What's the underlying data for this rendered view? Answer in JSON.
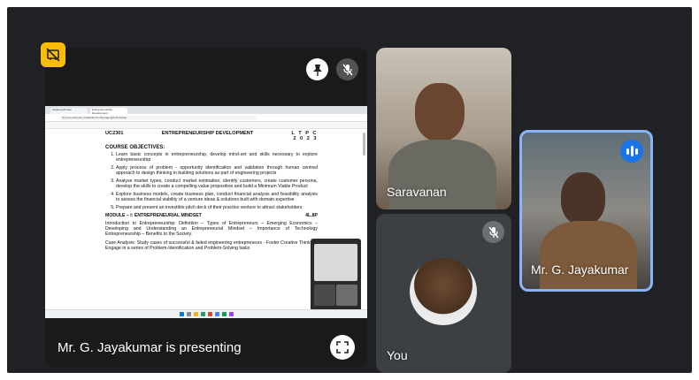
{
  "presentation": {
    "presenter_label": "Mr. G. Jayakumar is presenting"
  },
  "browser": {
    "tabs": [
      "subject-pdf-view",
      "Entrepreneurship Development"
    ],
    "url": "chrome-extension://efaidnbmnnnibpcajpcglclefindmkaj/"
  },
  "document": {
    "course_code": "UC2301",
    "course_title": "ENTREPRENEURSHIP DEVELOPMENT",
    "ltpc_header": "L T P C",
    "ltpc_values": "2 0 2 3",
    "objectives_heading": "COURSE OBJECTIVES:",
    "objectives": [
      "Learn basic concepts in entrepreneurship, develop mind-set and skills necessary to explore entrepreneurship",
      "Apply process of problem - opportunity identification and validation through human centred approach to design thinking in building solutions as part of engineering projects",
      "Analyse market types, conduct market estimation, identify customers, create customer persona, develop the skills to create a compelling value proposition and build a Minimum Viable Product",
      "Explore business models, create business plan, conduct financial analysis and feasibility analysis to assess the financial viability of a venture ideas & solutions built with domain expertise",
      "Prepare and present an investible pitch deck of their practice venture to attract stakeholders"
    ],
    "module_title": "MODULE – I: ENTREPRENEURIAL MINDSET",
    "module_hours": "4L,8P",
    "intro_paragraph": "Introduction to Entrepreneurship: Definition – Types of Entrepreneurs – Emerging Economics – Developing and Understanding an Entrepreneurial Mindset – Importance of Technology Entrepreneurship – Benefits to the Society.",
    "case_paragraph": "Case Analysis: Study cases of successful & failed engineering entrepreneurs - Foster Creative Thinking: Engage in a series of Problem-Identification and Problem-Solving tasks"
  },
  "participants": [
    {
      "name": "Saravanan",
      "muted": false
    },
    {
      "name": "You",
      "muted": true
    },
    {
      "name": "Mr. G. Jayakumar",
      "speaking": true
    }
  ],
  "colors": {
    "background": "#202124",
    "badge": "#fbbc04",
    "speaking": "#1a73e8",
    "active_border": "#8ab4f8"
  },
  "icons": [
    "presentation-off-icon",
    "pin-icon",
    "mic-off-icon",
    "fullscreen-icon",
    "speaking-icon"
  ]
}
